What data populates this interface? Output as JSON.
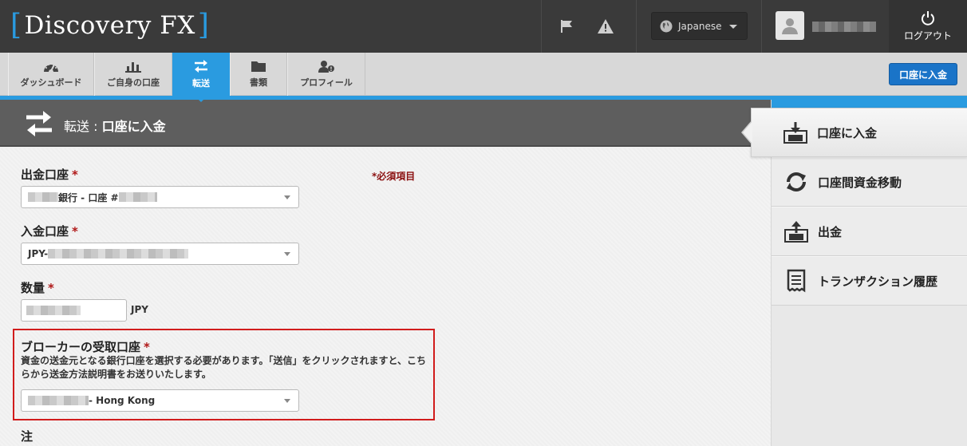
{
  "app": {
    "logo_name": "Discovery FX",
    "logo_left_bracket": "[",
    "logo_right_bracket": "]"
  },
  "header": {
    "language": "Japanese",
    "logout_label": "ログアウト",
    "icons": [
      "flag-icon",
      "warning-icon",
      "globe-icon",
      "user-icon",
      "power-icon"
    ]
  },
  "nav": {
    "tabs": [
      {
        "label": "ダッシュボード",
        "icon": "dashboard-icon"
      },
      {
        "label": "ご自身の口座",
        "icon": "bar-chart-icon"
      },
      {
        "label": "転送",
        "icon": "transfer-icon",
        "active": true
      },
      {
        "label": "書類",
        "icon": "folder-icon"
      },
      {
        "label": "プロフィール",
        "icon": "profile-icon"
      }
    ],
    "deposit_button": "口座に入金"
  },
  "page": {
    "section": "転送",
    "separator": " : ",
    "title": "口座に入金"
  },
  "form": {
    "required_note": "*必須項目",
    "from_account": {
      "label": "出金口座",
      "required_mark": "*",
      "value_mid": "銀行 - 口座 #"
    },
    "to_account": {
      "label": "入金口座",
      "required_mark": "*",
      "value_prefix": "JPY-"
    },
    "amount": {
      "label": "数量",
      "required_mark": "*",
      "unit": "JPY"
    },
    "broker_account": {
      "label": "ブローカーの受取口座",
      "required_mark": "*",
      "help": "資金の送金元となる銀行口座を選択する必要があります。「送信」をクリックされますと、こちらから送金方法説明書をお送りいたします。",
      "value_suffix": "- Hong Kong"
    },
    "note_label": "注"
  },
  "sidebar": {
    "items": [
      {
        "label": "口座に入金",
        "icon": "deposit-icon",
        "active": true
      },
      {
        "label": "口座間資金移動",
        "icon": "sync-icon"
      },
      {
        "label": "出金",
        "icon": "withdraw-icon"
      },
      {
        "label": "トランザクション履歴",
        "icon": "receipt-icon"
      }
    ]
  },
  "colors": {
    "accent": "#2a9be0",
    "header_bg": "#3a3a3a",
    "required": "#b01818",
    "highlight_border": "#d11c1c"
  }
}
